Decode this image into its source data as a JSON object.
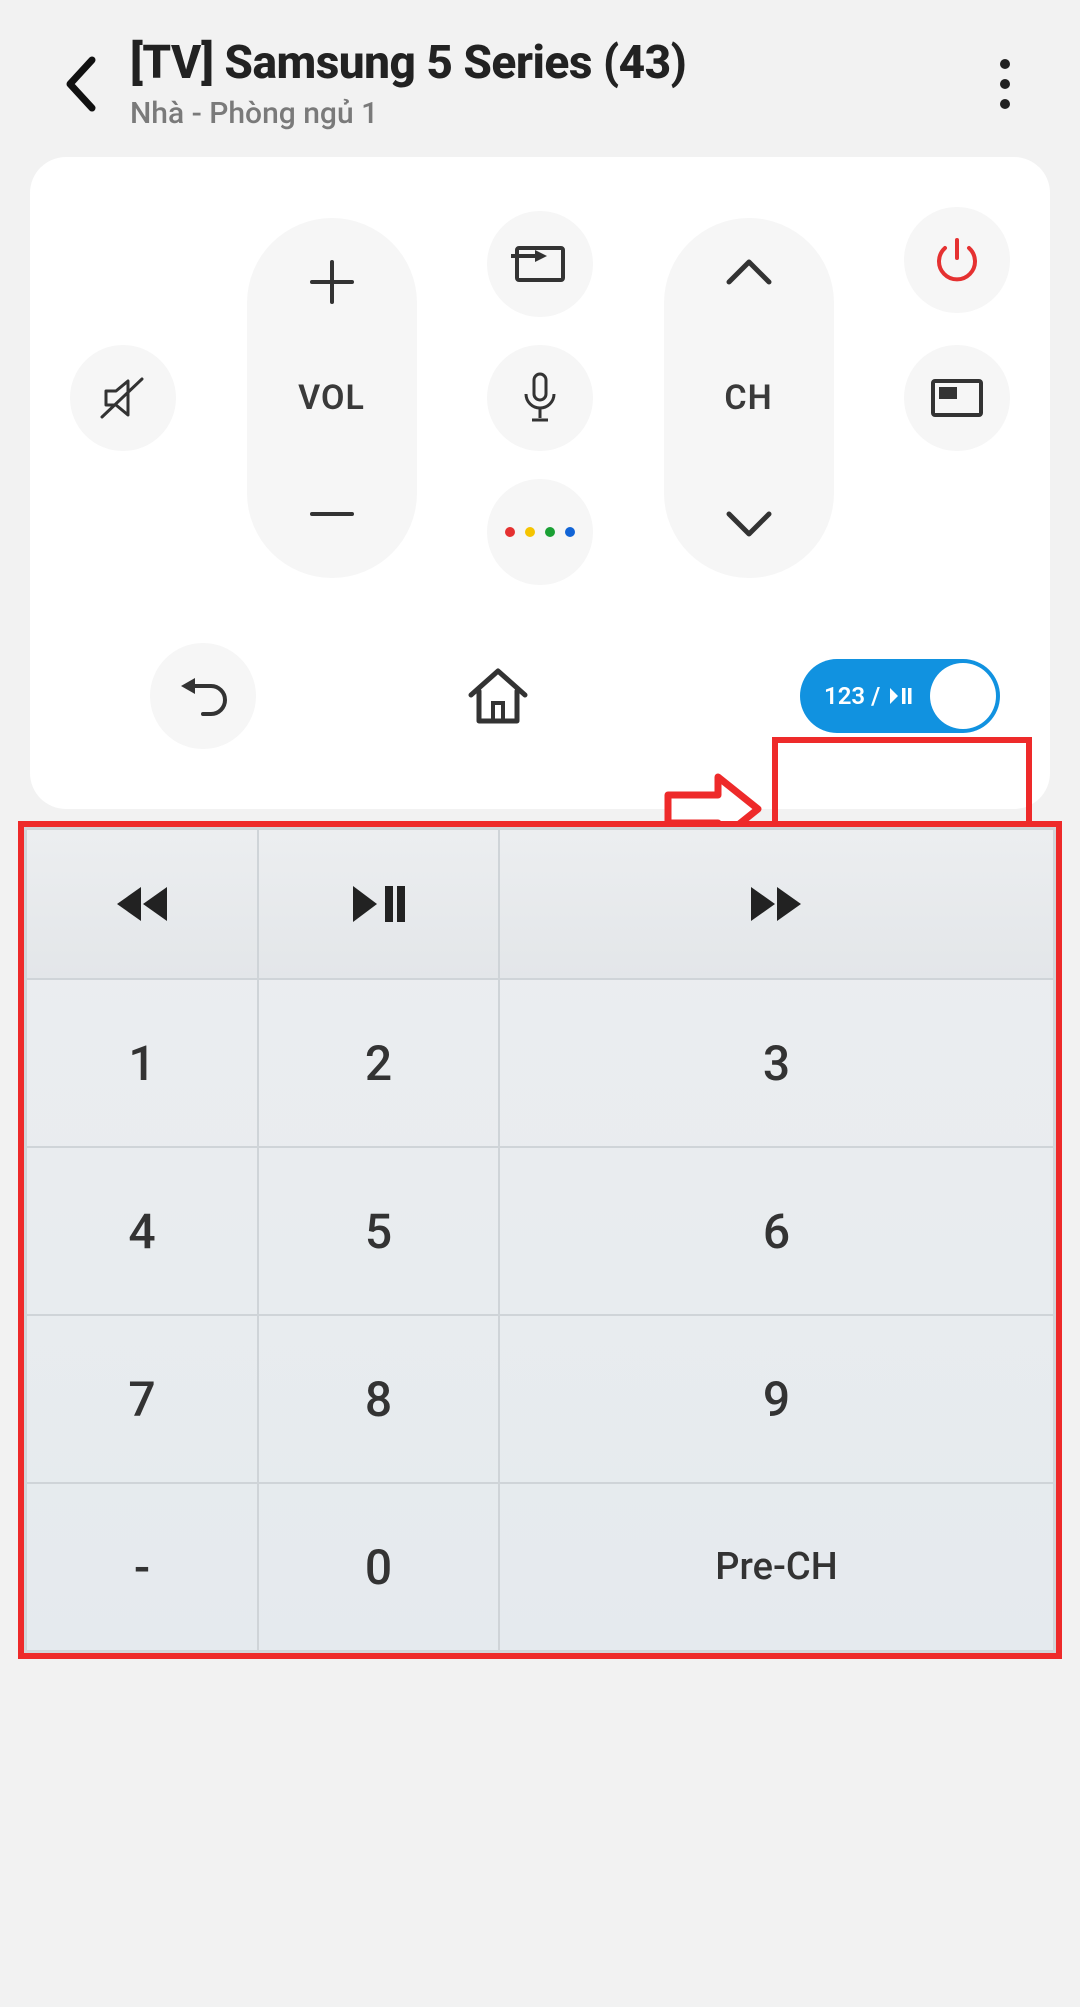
{
  "header": {
    "title": "[TV] Samsung 5 Series (43)",
    "subtitle": "Nhà - Phòng ngủ 1"
  },
  "remote": {
    "vol_label": "VOL",
    "ch_label": "CH",
    "toggle_label": "123 /",
    "dot_colors": [
      "#e53131",
      "#f5c400",
      "#1aa034",
      "#1164d6"
    ]
  },
  "keypad": {
    "media": [
      "rewind",
      "play-pause",
      "forward"
    ],
    "rows": [
      [
        "1",
        "2",
        "3"
      ],
      [
        "4",
        "5",
        "6"
      ],
      [
        "7",
        "8",
        "9"
      ],
      [
        "-",
        "0",
        "Pre-CH"
      ]
    ]
  },
  "colors": {
    "accent": "#1192e0",
    "power": "#e53131",
    "highlight": "#ee2a2a"
  }
}
